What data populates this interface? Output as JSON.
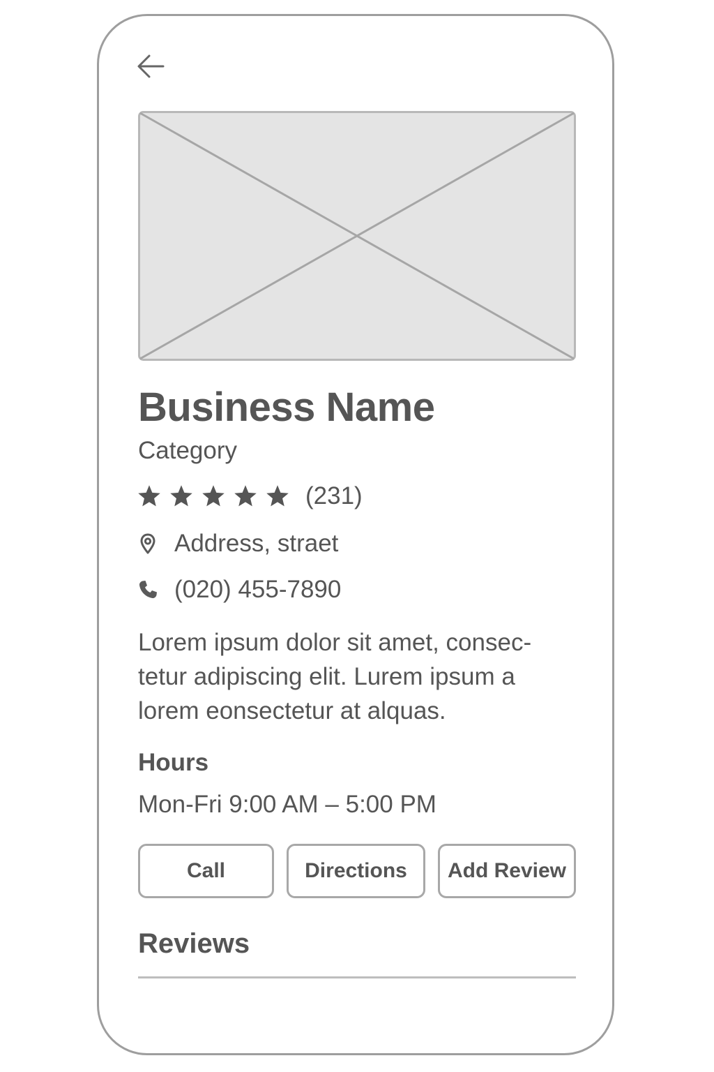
{
  "business": {
    "name": "Business Name",
    "category": "Category",
    "rating": 5,
    "review_count": "(231)",
    "address": "Address, straet",
    "phone": "(020) 455-7890",
    "description_lines": [
      "Lorem ipsum dolor sit amet, consec-",
      "tetur adipiscing elit. Lurem ipsum a",
      "lorem eonsectetur at alquas."
    ]
  },
  "hours": {
    "title": "Hours",
    "value": "Mon-Fri 9:00 AM – 5:00 PM"
  },
  "actions": {
    "call_label": "Call",
    "directions_label": "Directions",
    "add_review_label": "Add Review"
  },
  "reviews": {
    "title": "Reviews"
  },
  "icons": {
    "back": "arrow-left-icon",
    "hero": "image-placeholder",
    "star": "star-icon",
    "location": "map-pin-icon",
    "phone": "phone-icon"
  },
  "colors": {
    "text": "#555555",
    "border": "#a8a8a8",
    "placeholder_fill": "#e4e4e4",
    "placeholder_stroke": "#a6a6a6"
  }
}
